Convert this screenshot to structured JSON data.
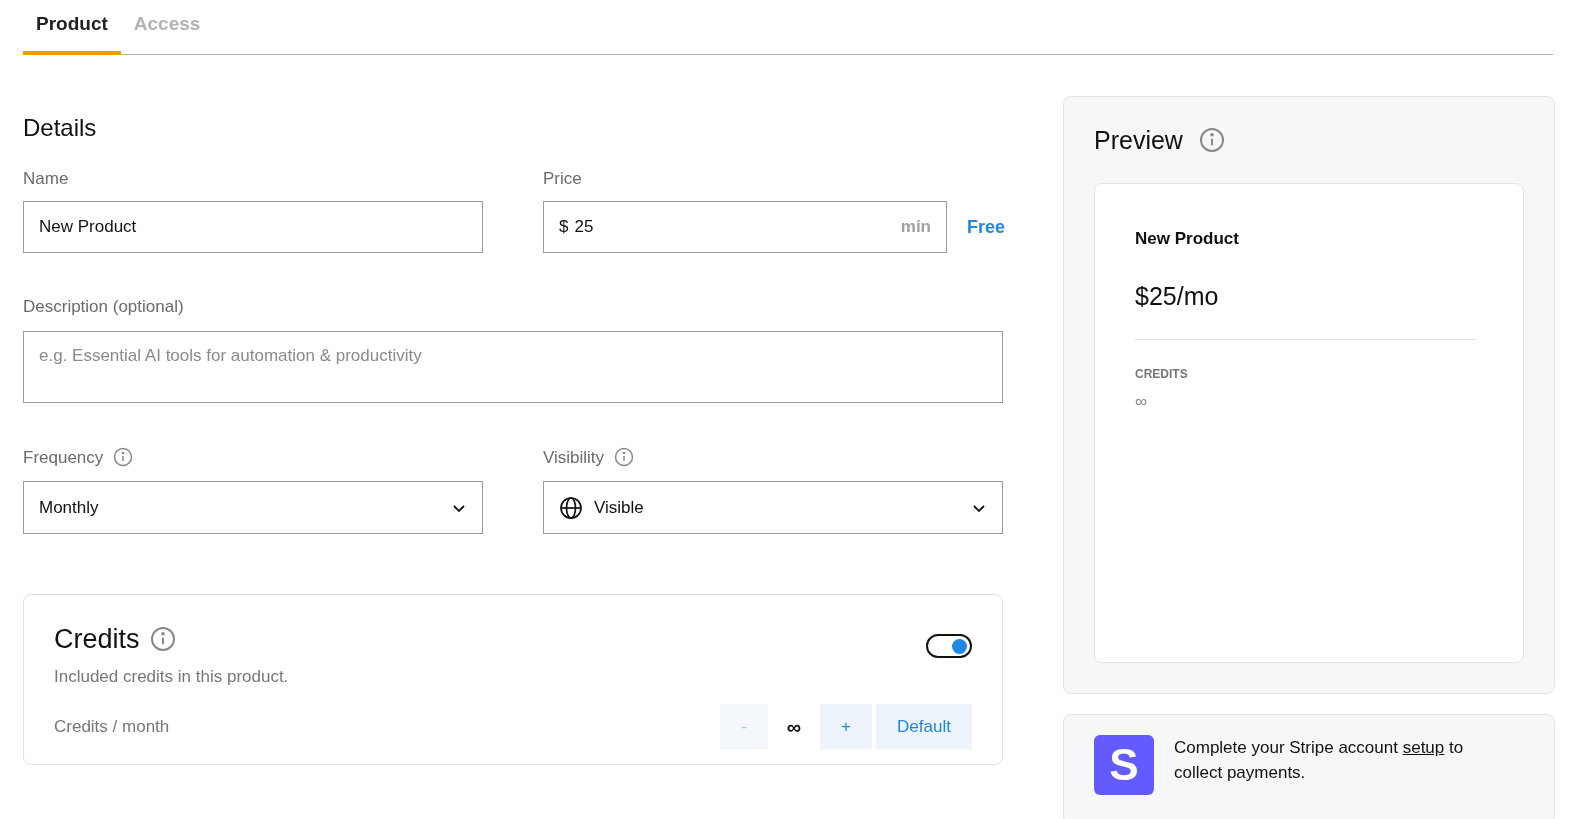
{
  "tabs": [
    {
      "label": "Product",
      "selected": true
    },
    {
      "label": "Access",
      "selected": false
    }
  ],
  "details": {
    "title": "Details",
    "name": {
      "label": "Name",
      "value": "New Product"
    },
    "price": {
      "label": "Price",
      "currency": "$",
      "value": "25",
      "suffix": "min",
      "free_link": "Free"
    },
    "description": {
      "label": "Description (optional)",
      "placeholder": "e.g. Essential AI tools for automation & productivity"
    },
    "frequency": {
      "label": "Frequency",
      "value": "Monthly"
    },
    "visibility": {
      "label": "Visibility",
      "value": "Visible"
    }
  },
  "credits": {
    "title": "Credits",
    "subtitle": "Included credits in this product.",
    "on": true,
    "row_label": "Credits / month",
    "minus": "-",
    "value": "∞",
    "plus": "+",
    "default": "Default"
  },
  "preview": {
    "title": "Preview",
    "product_name": "New Product",
    "price": "$25/mo",
    "credits_label": "CREDITS",
    "credits_value": "∞"
  },
  "stripe": {
    "logo": "S",
    "text_before": "Complete your Stripe account ",
    "link": "setup",
    "text_after": " to collect payments."
  }
}
